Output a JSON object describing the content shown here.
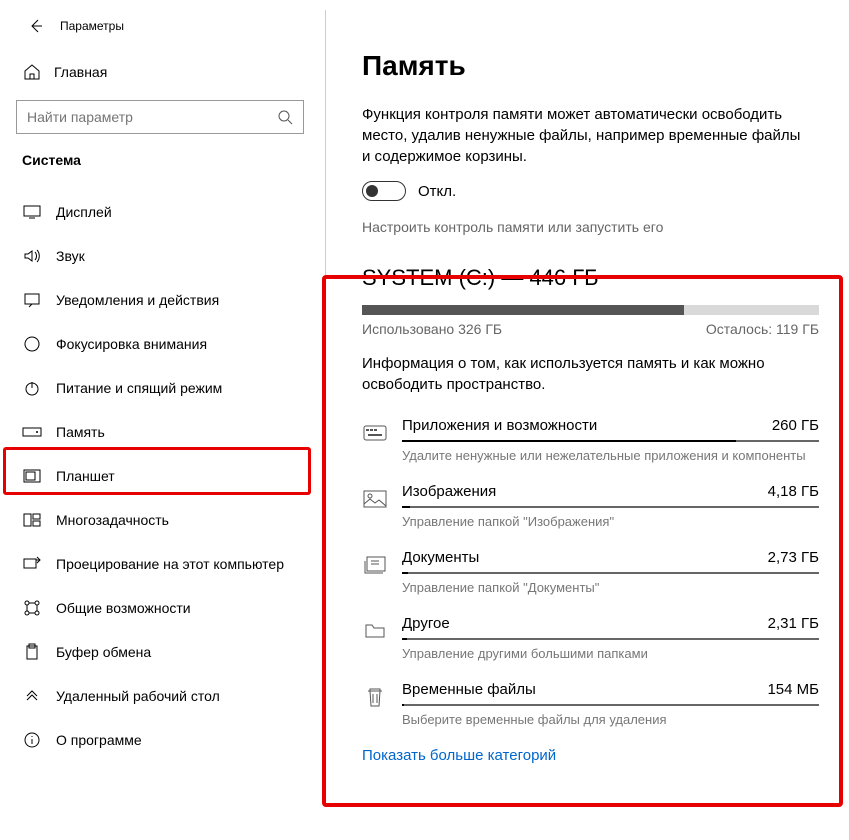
{
  "header": {
    "title": "Параметры"
  },
  "home": {
    "label": "Главная"
  },
  "search": {
    "placeholder": "Найти параметр"
  },
  "section": {
    "title": "Система"
  },
  "nav": {
    "items": [
      {
        "label": "Дисплей"
      },
      {
        "label": "Звук"
      },
      {
        "label": "Уведомления и действия"
      },
      {
        "label": "Фокусировка внимания"
      },
      {
        "label": "Питание и спящий режим"
      },
      {
        "label": "Память"
      },
      {
        "label": "Планшет"
      },
      {
        "label": "Многозадачность"
      },
      {
        "label": "Проецирование на этот компьютер"
      },
      {
        "label": "Общие возможности"
      },
      {
        "label": "Буфер обмена"
      },
      {
        "label": "Удаленный рабочий стол"
      },
      {
        "label": "О программе"
      }
    ]
  },
  "main": {
    "title": "Память",
    "description": "Функция контроля памяти может автоматически освободить место, удалив ненужные файлы, например временные файлы и содержимое корзины.",
    "toggle_label": "Откл.",
    "configure": "Настроить контроль памяти или запустить его",
    "drive": {
      "title": "SYSTEM (C:) — 446 ГБ",
      "used": "Использовано 326 ГБ",
      "free": "Осталось: 119 ГБ",
      "desc": "Информация о том, как используется память и как можно освободить пространство.",
      "categories": [
        {
          "name": "Приложения и возможности",
          "size": "260 ГБ",
          "sub": "Удалите ненужные или нежелательные приложения и компоненты"
        },
        {
          "name": "Изображения",
          "size": "4,18 ГБ",
          "sub": "Управление папкой \"Изображения\""
        },
        {
          "name": "Документы",
          "size": "2,73 ГБ",
          "sub": "Управление папкой \"Документы\""
        },
        {
          "name": "Другое",
          "size": "2,31 ГБ",
          "sub": "Управление другими большими папками"
        },
        {
          "name": "Временные файлы",
          "size": "154 МБ",
          "sub": "Выберите временные файлы для удаления"
        }
      ],
      "show_more": "Показать больше категорий"
    }
  }
}
